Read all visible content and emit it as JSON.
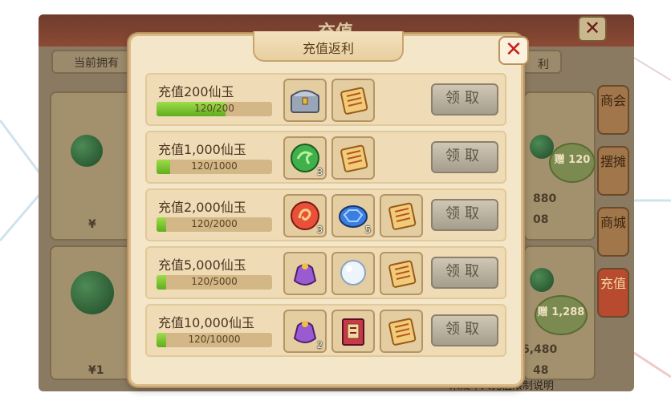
{
  "store": {
    "title": "充值",
    "balance_label": "当前拥有",
    "balance_right": "利",
    "close_glyph": "✕",
    "tabs": [
      {
        "label": "商会"
      },
      {
        "label": "摆摊"
      },
      {
        "label": "商城"
      },
      {
        "label": "充值",
        "active": true
      }
    ],
    "gift_badges": [
      "赠 120",
      "赠 1,288"
    ],
    "left_values": [
      "¥",
      "¥1"
    ],
    "right_values": [
      "880",
      "08",
      "6,480",
      "48"
    ],
    "footer": "未成年人充值限制说明"
  },
  "dialog": {
    "title": "充值返利",
    "close_glyph": "✕",
    "rows": [
      {
        "label": "充值200仙玉",
        "progress_text": "120/200",
        "progress": 0.6,
        "rewards": [
          {
            "icon": "treasure-chest-icon",
            "count": ""
          },
          {
            "icon": "scroll-icon",
            "count": ""
          }
        ],
        "button": "领取"
      },
      {
        "label": "充值1,000仙玉",
        "progress_text": "120/1000",
        "progress": 0.12,
        "rewards": [
          {
            "icon": "green-jade-orb-icon",
            "count": "3"
          },
          {
            "icon": "scroll-icon",
            "count": ""
          }
        ],
        "button": "领取"
      },
      {
        "label": "充值2,000仙玉",
        "progress_text": "120/2000",
        "progress": 0.06,
        "rewards": [
          {
            "icon": "red-fire-orb-icon",
            "count": "3"
          },
          {
            "icon": "blue-turtle-icon",
            "count": "5"
          },
          {
            "icon": "scroll-icon",
            "count": ""
          }
        ],
        "button": "领取"
      },
      {
        "label": "充值5,000仙玉",
        "progress_text": "120/5000",
        "progress": 0.024,
        "rewards": [
          {
            "icon": "purple-pouch-icon",
            "count": ""
          },
          {
            "icon": "pearl-icon",
            "count": ""
          },
          {
            "icon": "scroll-icon",
            "count": ""
          }
        ],
        "button": "领取"
      },
      {
        "label": "充值10,000仙玉",
        "progress_text": "120/10000",
        "progress": 0.012,
        "rewards": [
          {
            "icon": "purple-pouch-icon",
            "count": "2"
          },
          {
            "icon": "red-book-icon",
            "count": ""
          },
          {
            "icon": "scroll-icon",
            "count": ""
          }
        ],
        "button": "领取"
      }
    ]
  }
}
